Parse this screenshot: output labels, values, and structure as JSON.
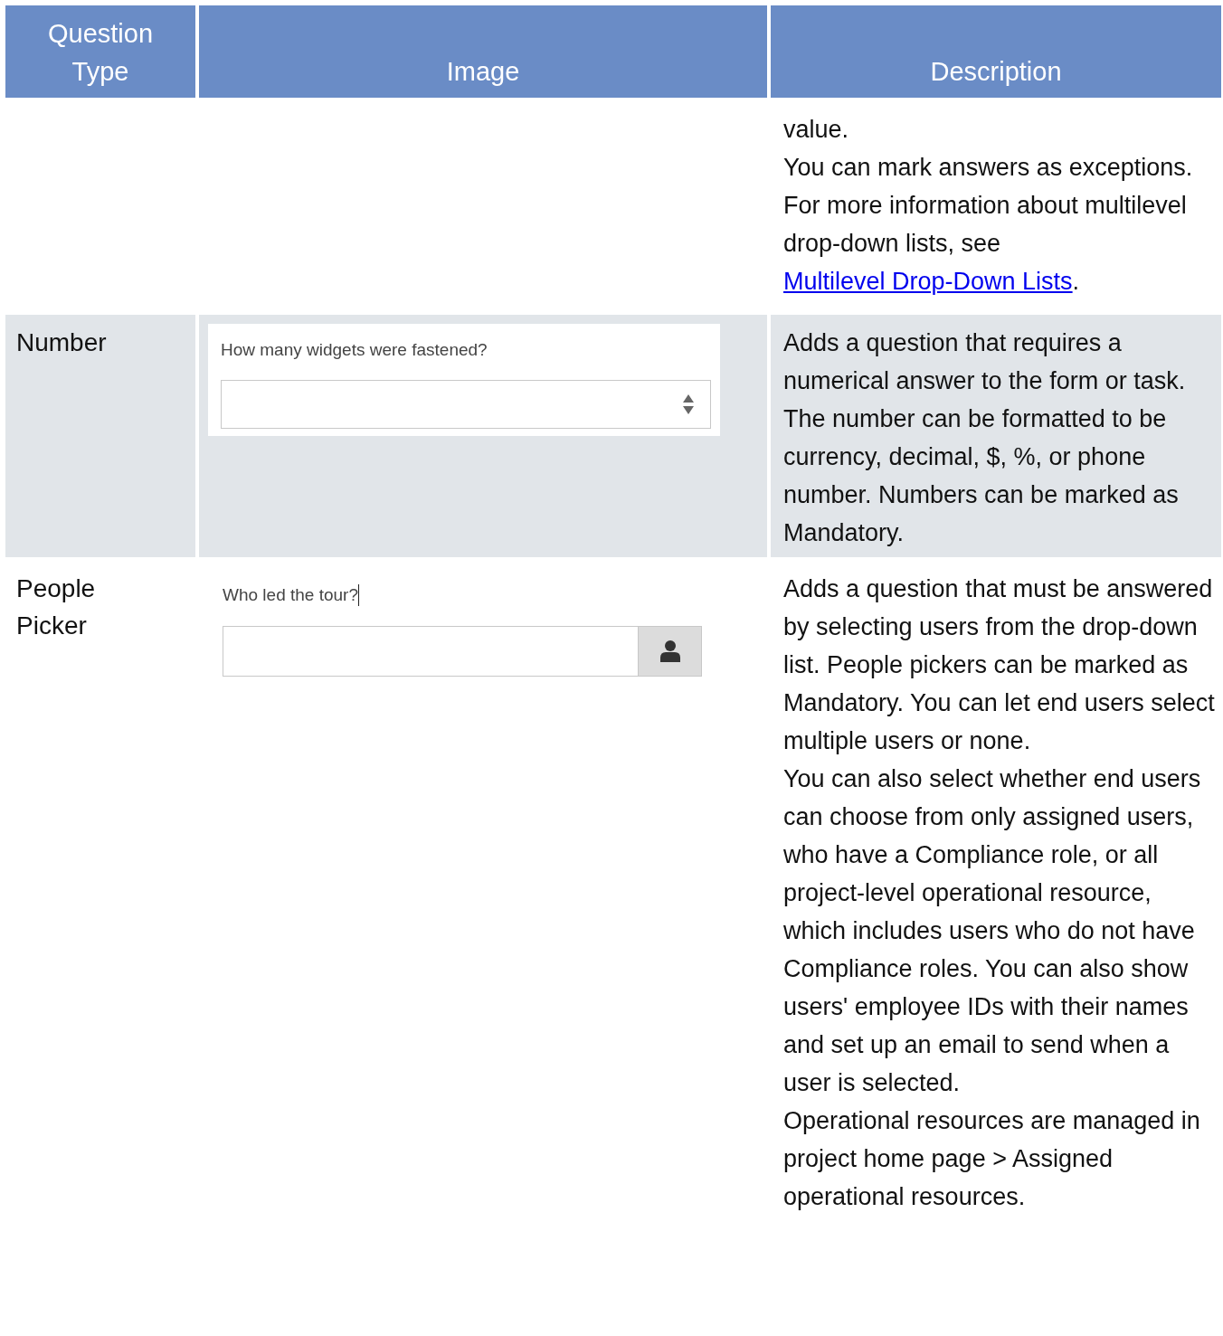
{
  "table": {
    "columns": [
      "Question Type",
      "Image",
      "Description"
    ],
    "rows": [
      {
        "type": "",
        "description": [
          {
            "text": "value."
          },
          {
            "text": "You can mark answers as exceptions."
          },
          {
            "text": "For more information about multilevel drop-down lists, see ",
            "link": "Multilevel Drop-Down Lists",
            "after": "."
          }
        ]
      },
      {
        "type": "Number",
        "image": {
          "kind": "number",
          "question": "How many widgets were fastened?"
        },
        "description": [
          {
            "text": "Adds a question that requires a numerical answer to the form or task. The number can be formatted to be currency, decimal, $, %, or phone number. Numbers can be marked as Mandatory."
          }
        ]
      },
      {
        "type": "People Picker",
        "image": {
          "kind": "people",
          "question": "Who led the tour?"
        },
        "description": [
          {
            "text": "Adds a question that must be answered by selecting users from the drop-down list. People pickers can be marked as Mandatory. You can let end users select multiple users or none."
          },
          {
            "text": "You can also select whether end users can choose from only assigned users, who have a Compliance role, or all project-level operational resource, which includes users who do not have Compliance roles. You can also show users' employee IDs with their names and set up an email to send when a user is selected."
          },
          {
            "text": "Operational resources are managed in project home page > Assigned operational resources."
          }
        ]
      }
    ]
  }
}
